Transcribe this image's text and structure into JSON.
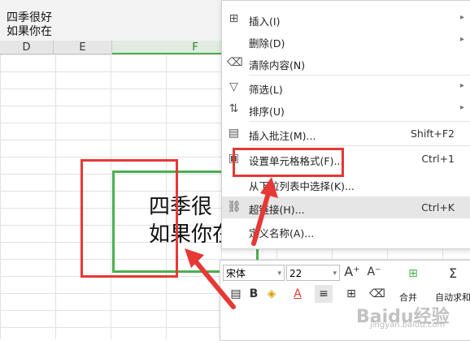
{
  "formula_bar": {
    "content_line1": "四季很好",
    "content_line2": "如果你在"
  },
  "columns": [
    "D",
    "E",
    "F"
  ],
  "cell": {
    "line1": "四季很",
    "line2": "如果你在"
  },
  "context_menu": {
    "items": [
      {
        "label": "插入(I)",
        "icon": "insert-icon",
        "arrow": true
      },
      {
        "label": "删除(D)",
        "icon": "",
        "arrow": true
      },
      {
        "label": "清除内容(N)",
        "icon": "eraser-icon",
        "arrow": false
      },
      {
        "label": "筛选(L)",
        "icon": "filter-icon",
        "arrow": true
      },
      {
        "label": "排序(U)",
        "icon": "sort-icon",
        "arrow": true
      },
      {
        "label": "插入批注(M)...",
        "icon": "comment-icon",
        "shortcut": "Shift+F2"
      },
      {
        "label": "设置单元格格式(F)...",
        "icon": "format-icon",
        "shortcut": "Ctrl+1"
      },
      {
        "label": "从下拉列表中选择(K)...",
        "icon": ""
      },
      {
        "label": "超链接(H)...",
        "icon": "link-icon",
        "shortcut": "Ctrl+K"
      },
      {
        "label": "定义名称(A)...",
        "icon": ""
      }
    ]
  },
  "toolbar": {
    "font_name": "宋体",
    "font_size": "22",
    "merge_label": "合并",
    "autosum_label": "自动求和"
  },
  "watermark": {
    "text": "Baidu经验",
    "sub": "jingyan.baidu.com"
  },
  "colors": {
    "accent_green": "#4caf50",
    "annotation_red": "#e53935"
  }
}
